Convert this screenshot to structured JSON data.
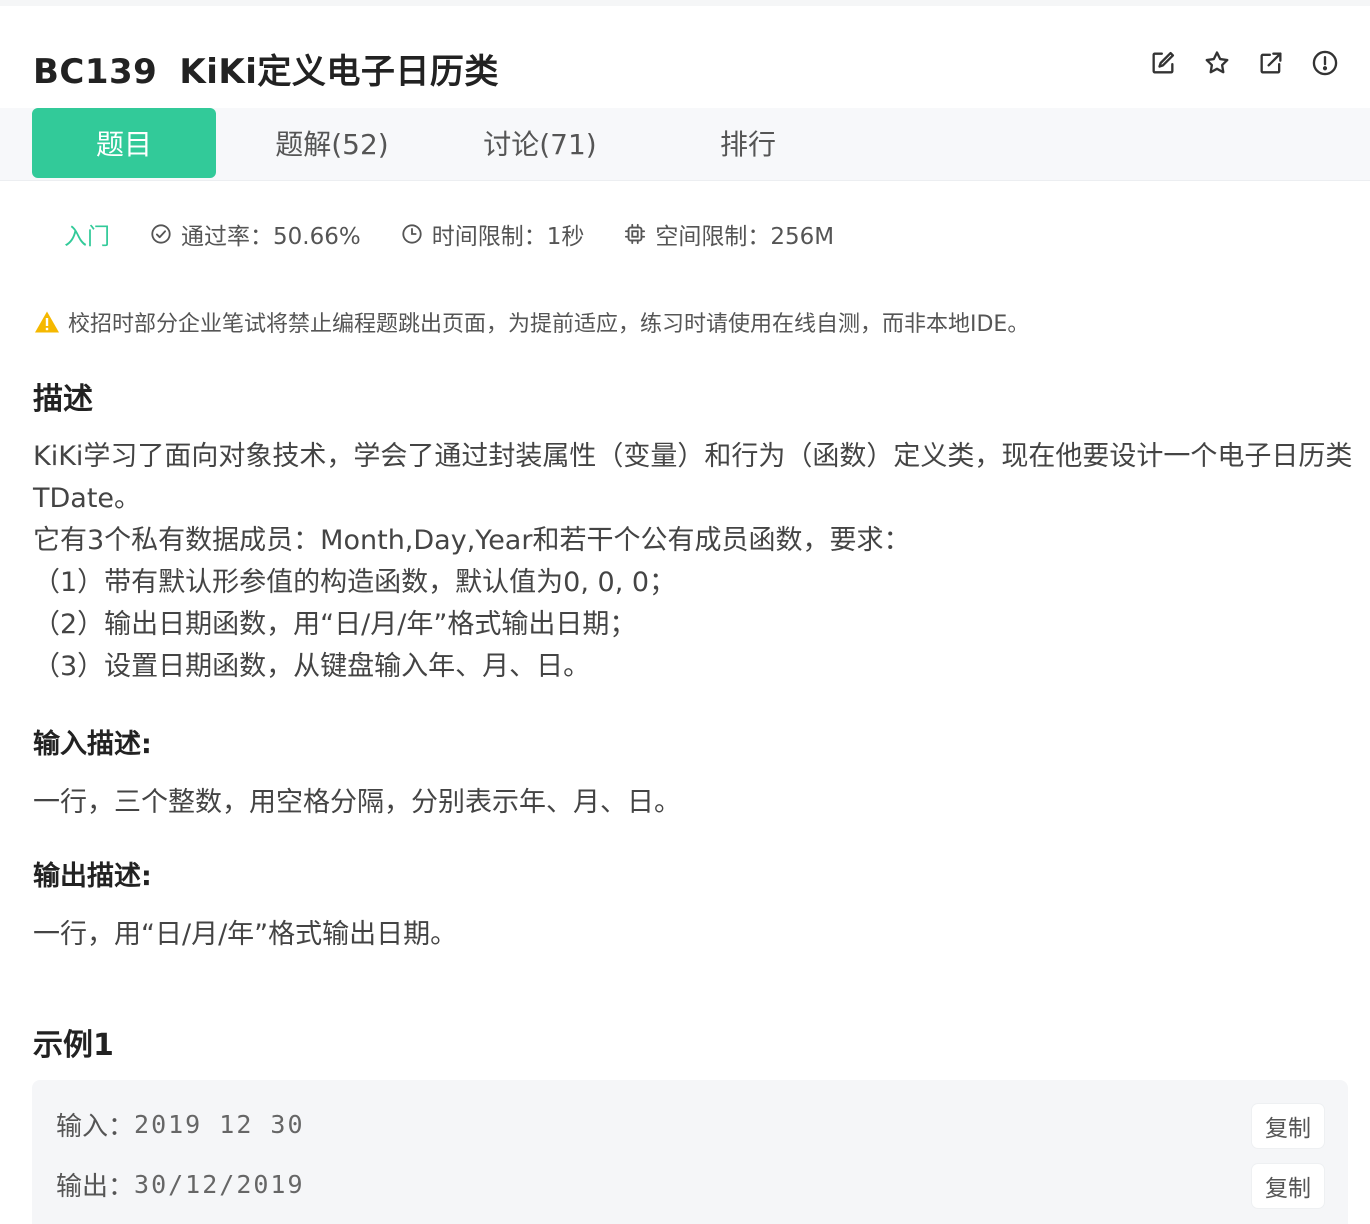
{
  "header": {
    "problem_id": "BC139",
    "problem_title": "KiKi定义电子日历类",
    "icons": [
      "edit-icon",
      "star-icon",
      "external-link-icon",
      "report-icon"
    ]
  },
  "tabs": [
    {
      "label": "题目",
      "active": true
    },
    {
      "label": "题解(52)",
      "active": false
    },
    {
      "label": "讨论(71)",
      "active": false
    },
    {
      "label": "排行",
      "active": false
    }
  ],
  "meta": {
    "difficulty": "入门",
    "pass_rate": "通过率：50.66%",
    "time_limit": "时间限制：1秒",
    "memory_limit": "空间限制：256M"
  },
  "warning": "校招时部分企业笔试将禁止编程题跳出页面，为提前适应，练习时请使用在线自测，而非本地IDE。",
  "description": {
    "title": "描述",
    "lines": [
      "KiKi学习了面向对象技术，学会了通过封装属性（变量）和行为（函数）定义类，现在他要设计一个电子日历类TDate。",
      "它有3个私有数据成员：Month,Day,Year和若干个公有成员函数，要求：",
      "（1）带有默认形参值的构造函数，默认值为0, 0, 0；",
      "（2）输出日期函数，用“日/月/年”格式输出日期；",
      "（3）设置日期函数，从键盘输入年、月、日。"
    ]
  },
  "input_desc": {
    "title": "输入描述:",
    "text": "一行，三个整数，用空格分隔，分别表示年、月、日。"
  },
  "output_desc": {
    "title": "输出描述:",
    "text": "一行，用“日/月/年”格式输出日期。"
  },
  "example": {
    "title": "示例1",
    "input_label": "输入：",
    "input_value": "2019 12 30",
    "output_label": "输出：",
    "output_value": "30/12/2019",
    "copy_label": "复制"
  },
  "colors": {
    "accent": "#32ca99",
    "warning": "#f5b800"
  }
}
